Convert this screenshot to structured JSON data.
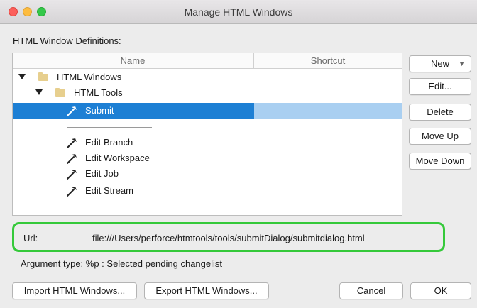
{
  "window": {
    "title": "Manage HTML Windows"
  },
  "definitions": {
    "label": "HTML Window Definitions:",
    "columns": {
      "name": "Name",
      "shortcut": "Shortcut"
    },
    "tree": [
      {
        "label": "HTML Windows",
        "icon": "folder-icon",
        "expanded": true
      },
      {
        "label": "HTML Tools",
        "icon": "folder-icon",
        "expanded": true
      },
      {
        "label": "Submit",
        "icon": "hammer-icon",
        "selected": true,
        "shortcut": ""
      },
      {
        "label": "Edit Branch",
        "icon": "hammer-icon"
      },
      {
        "label": "Edit Workspace",
        "icon": "hammer-icon"
      },
      {
        "label": "Edit Job",
        "icon": "hammer-icon"
      },
      {
        "label": "Edit Stream",
        "icon": "hammer-icon"
      }
    ]
  },
  "side_buttons": {
    "new": "New",
    "edit": "Edit...",
    "delete": "Delete",
    "move_up": "Move Up",
    "move_down": "Move Down"
  },
  "url": {
    "label": "Url:",
    "value": "file:///Users/perforce/htmtools/tools/submitDialog/submitdialog.html"
  },
  "argument": {
    "text": "Argument type:  %p :  Selected pending changelist"
  },
  "bottom_buttons": {
    "import": "Import HTML Windows...",
    "export": "Export HTML Windows...",
    "cancel": "Cancel",
    "ok": "OK"
  },
  "colors": {
    "selection": "#1d7fd4",
    "selection_secondary": "#a9cff1",
    "highlight_border": "#35c93a"
  }
}
